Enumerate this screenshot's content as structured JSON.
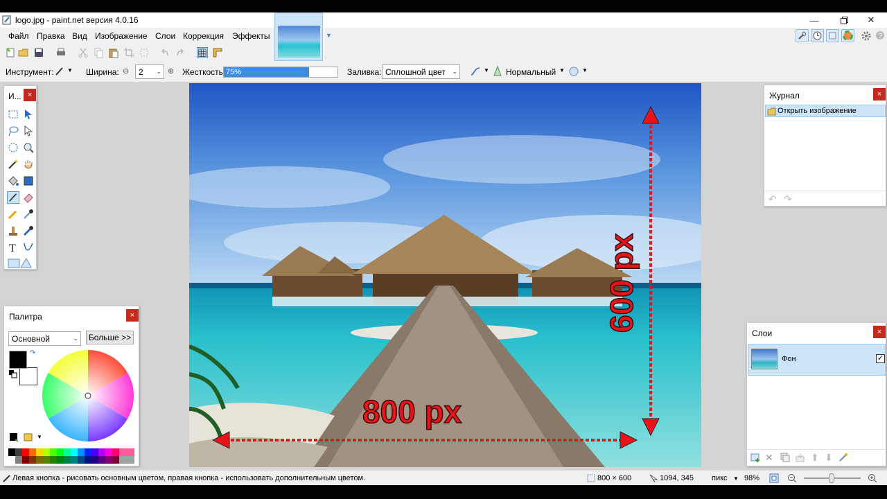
{
  "window": {
    "title": "logo.jpg - paint.net версия 4.0.16"
  },
  "menu": [
    "Файл",
    "Правка",
    "Вид",
    "Изображение",
    "Слои",
    "Коррекция",
    "Эффекты"
  ],
  "toolbar": {
    "tool_label": "Инструмент:",
    "width_label": "Ширина:",
    "width_value": "2",
    "hardness_label": "Жесткость:",
    "hardness_value": "75%",
    "hardness_fraction": 0.75,
    "fill_label": "Заливка:",
    "fill_value": "Сплошной цвет",
    "blend_value": "Нормальный"
  },
  "tools_panel": {
    "title": "И..."
  },
  "palette_panel": {
    "title": "Палитра",
    "mode_value": "Основной",
    "more_button": "Больше >>",
    "primary_color": "#000000",
    "secondary_color": "#ffffff"
  },
  "history_panel": {
    "title": "Журнал",
    "items": [
      "Открыть изображение"
    ]
  },
  "layers_panel": {
    "title": "Слои",
    "layers": [
      {
        "name": "Фон",
        "visible": true
      }
    ]
  },
  "canvas": {
    "annotation_width": "800 px",
    "annotation_height": "600 px"
  },
  "status": {
    "hint": "Левая кнопка - рисовать основным цветом, правая кнопка - использовать дополнительным цветом.",
    "image_size": "800 × 600",
    "cursor_pos": "1094, 345",
    "units": "пикс",
    "zoom": "98%"
  },
  "colors": {
    "accent": "#3d8ee5",
    "close": "#c42b1c",
    "annotation": "#e8141a"
  }
}
